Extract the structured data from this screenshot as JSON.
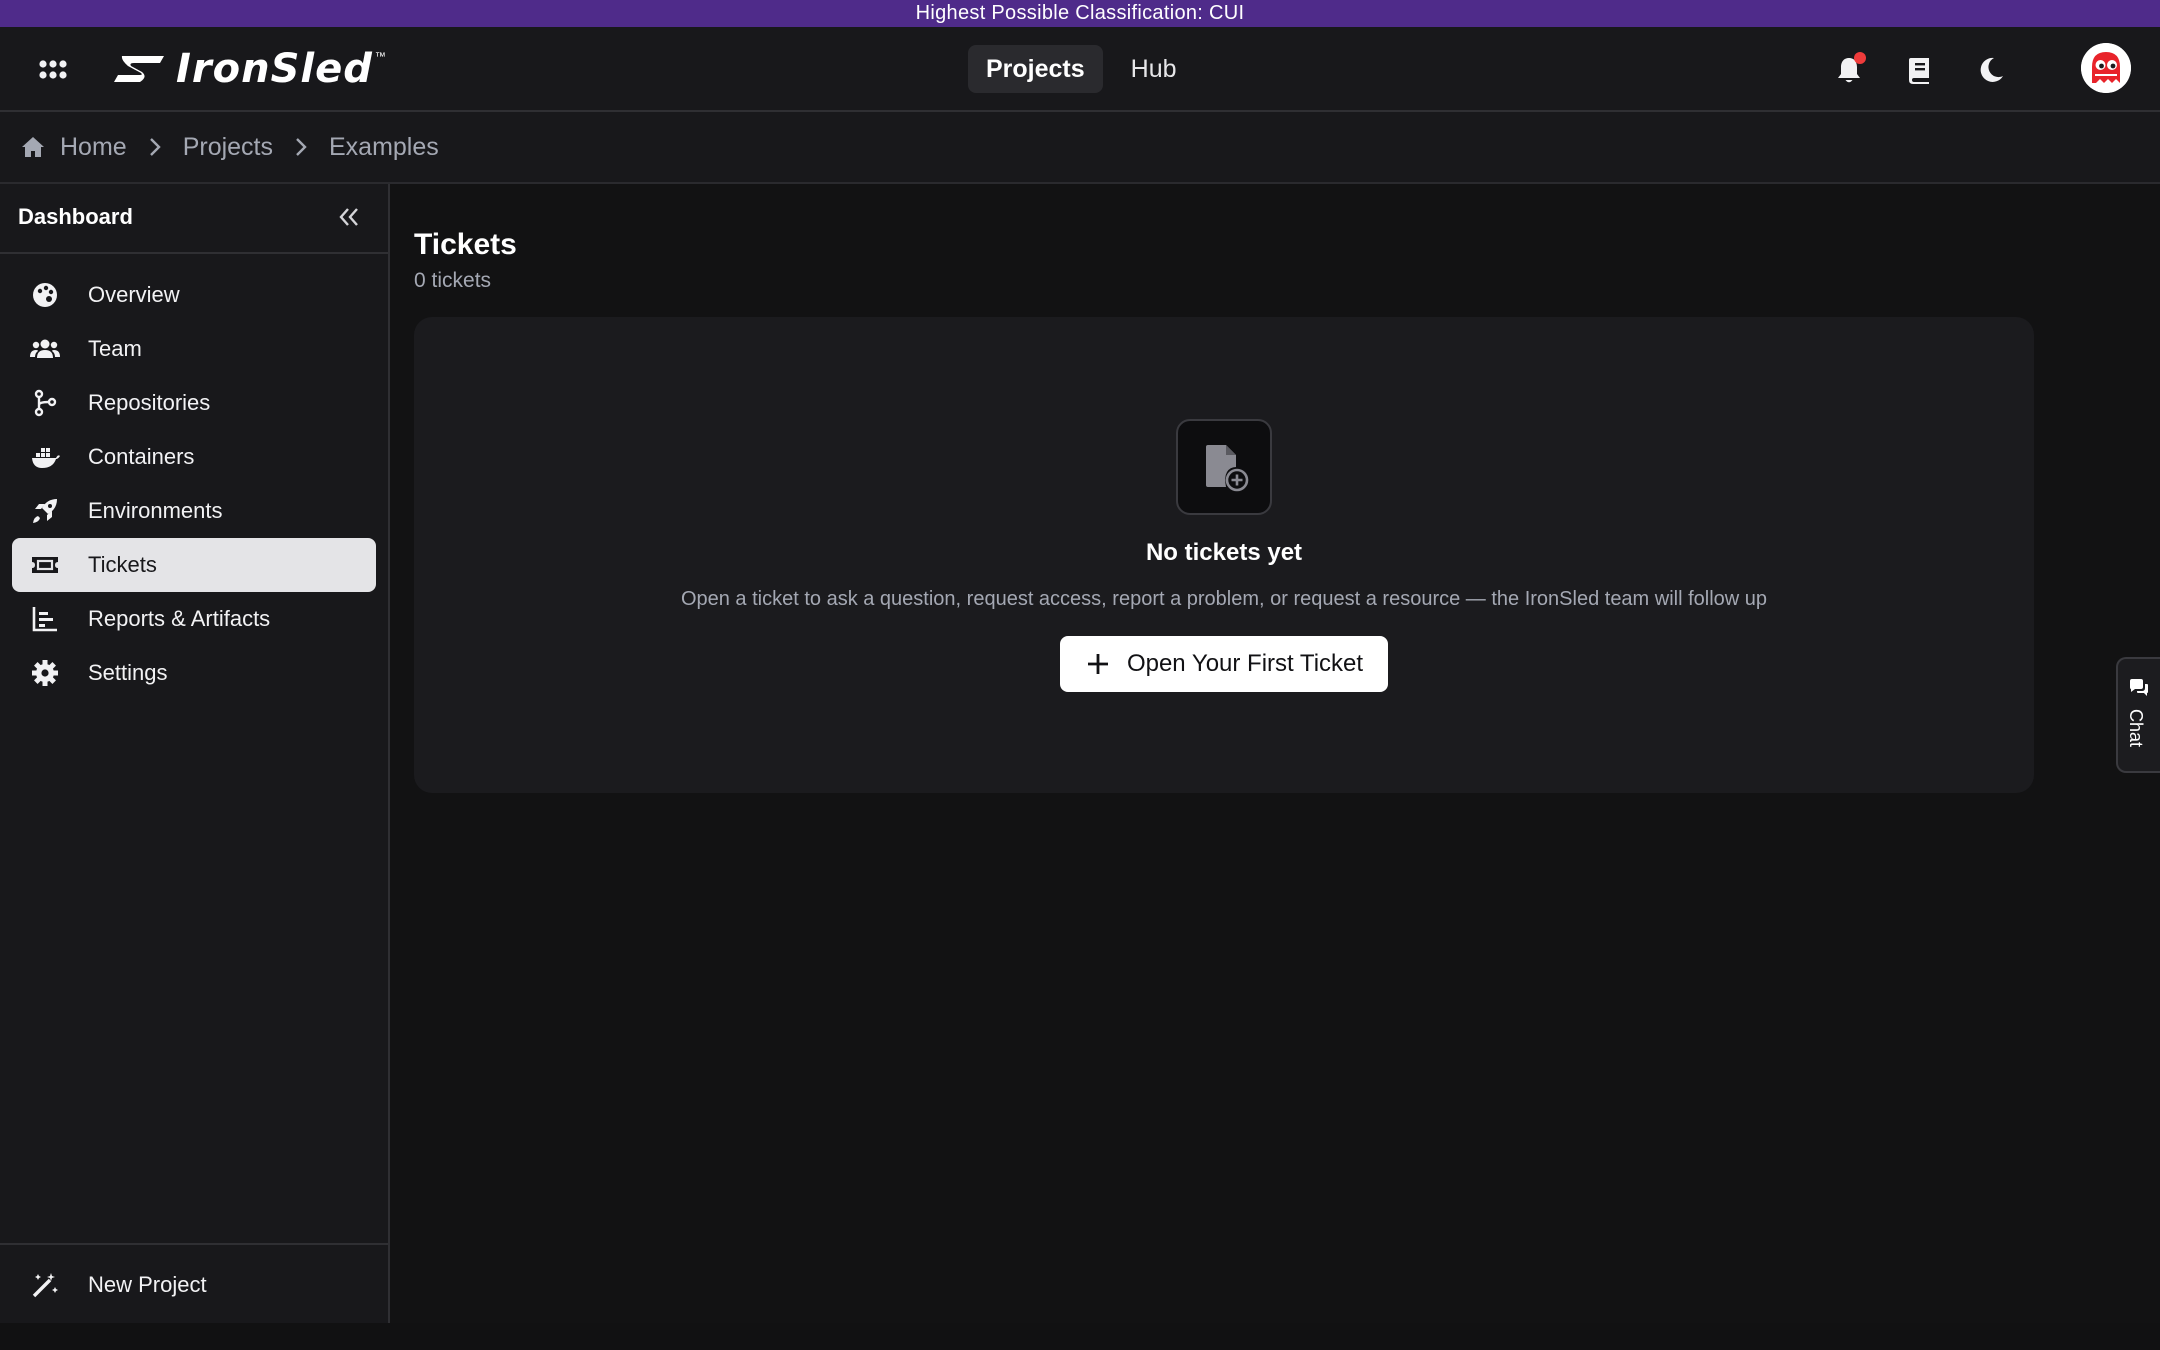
{
  "banner": {
    "text": "Highest Possible Classification: CUI"
  },
  "header": {
    "logo_text": "IronSled",
    "logo_tm": "™",
    "nav": [
      {
        "label": "Projects",
        "active": true
      },
      {
        "label": "Hub",
        "active": false
      }
    ],
    "icons": [
      "apps-grid-icon",
      "bell-icon",
      "book-icon",
      "moon-icon",
      "avatar"
    ]
  },
  "breadcrumb": [
    {
      "label": "Home",
      "icon": "home-icon"
    },
    {
      "label": "Projects"
    },
    {
      "label": "Examples"
    }
  ],
  "sidebar": {
    "title": "Dashboard",
    "items": [
      {
        "label": "Overview",
        "icon": "palette-icon",
        "active": false
      },
      {
        "label": "Team",
        "icon": "users-icon",
        "active": false
      },
      {
        "label": "Repositories",
        "icon": "branch-icon",
        "active": false
      },
      {
        "label": "Containers",
        "icon": "docker-icon",
        "active": false
      },
      {
        "label": "Environments",
        "icon": "rocket-icon",
        "active": false
      },
      {
        "label": "Tickets",
        "icon": "ticket-icon",
        "active": true
      },
      {
        "label": "Reports & Artifacts",
        "icon": "chart-icon",
        "active": false
      },
      {
        "label": "Settings",
        "icon": "gear-icon",
        "active": false
      }
    ],
    "footer": {
      "label": "New Project",
      "icon": "magic-wand-icon"
    }
  },
  "main": {
    "title": "Tickets",
    "subtitle": "0 tickets",
    "empty_state": {
      "icon": "file-plus-icon",
      "title": "No tickets yet",
      "description": "Open a ticket to ask a question, request access, report a problem, or request a resource — the IronSled team will follow up",
      "button_label": "Open Your First Ticket"
    }
  },
  "chat": {
    "label": "Chat"
  },
  "colors": {
    "banner": "#4f2b8a",
    "background": "#121213",
    "panel": "#18181b",
    "active_item": "#e4e4e7",
    "notification_dot": "#ef3b3b",
    "avatar_red": "#e8232a"
  }
}
